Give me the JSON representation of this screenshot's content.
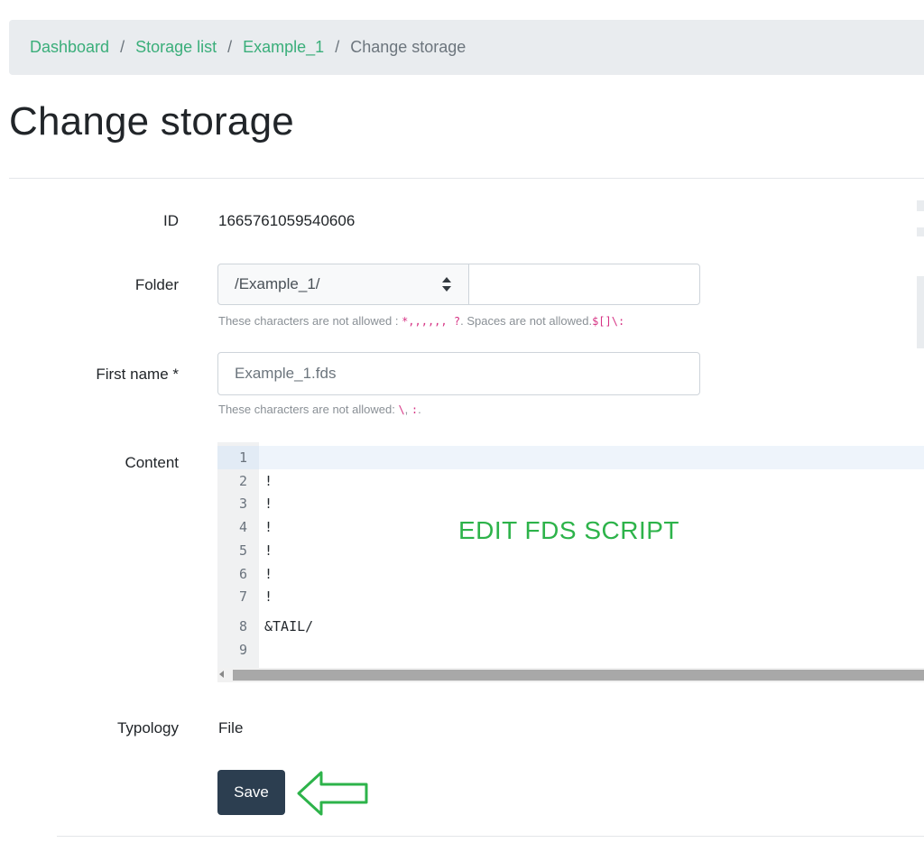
{
  "breadcrumb": {
    "items": [
      {
        "label": "Dashboard"
      },
      {
        "label": "Storage list"
      },
      {
        "label": "Example_1"
      }
    ],
    "separator": "/",
    "current": "Change storage"
  },
  "page": {
    "title": "Change storage"
  },
  "form": {
    "id": {
      "label": "ID",
      "value": "1665761059540606"
    },
    "folder": {
      "label": "Folder",
      "select_value": "/Example_1/",
      "input_value": "",
      "help_prefix": "These characters are not allowed : ",
      "help_chars": "*,,,,,, ?",
      "help_middle": ". Spaces are not allowed.",
      "help_chars2": "$[]\\:"
    },
    "first_name": {
      "label": "First name *",
      "value": "Example_1.fds",
      "help_prefix": "These characters are not allowed: ",
      "help_chars": "\\",
      "help_sep": ", ",
      "help_chars2": ":",
      "help_end": "."
    },
    "content": {
      "label": "Content",
      "lines": [
        {
          "number": "1",
          "text": ""
        },
        {
          "number": "2",
          "text": "!"
        },
        {
          "number": "3",
          "text": "!"
        },
        {
          "number": "4",
          "text": "!"
        },
        {
          "number": "5",
          "text": "!"
        },
        {
          "number": "6",
          "text": "!"
        },
        {
          "number": "7",
          "text": "!"
        },
        {
          "number": "8",
          "text": "&TAIL/"
        },
        {
          "number": "9",
          "text": ""
        }
      ],
      "overlay_text": "EDIT FDS SCRIPT"
    },
    "typology": {
      "label": "Typology",
      "value": "File"
    }
  },
  "actions": {
    "save_label": "Save"
  },
  "colors": {
    "link": "#3aae7a",
    "button": "#2c3e50",
    "annotation": "#2db34a",
    "breadcrumb_bg": "#e9ecef"
  },
  "icons": {
    "folder_select": "sort-icon",
    "save_pointer": "arrow-left-icon"
  }
}
